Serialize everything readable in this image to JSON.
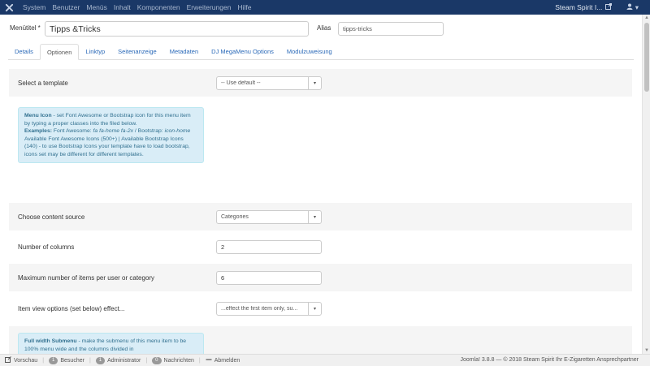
{
  "topbar": {
    "logo_icon": "joomla-icon",
    "menu": [
      "System",
      "Benutzer",
      "Menüs",
      "Inhalt",
      "Komponenten",
      "Erweiterungen",
      "Hilfe"
    ],
    "site_name": "Steam Spirit I...",
    "site_icon": "external-link-icon",
    "user_icon": "user-icon",
    "user_caret": "▾"
  },
  "form": {
    "menutitle_label": "Menütitel *",
    "menutitle_value": "Tipps &Tricks",
    "alias_label": "Alias",
    "alias_value": "tipps-tricks"
  },
  "tabs": [
    "Details",
    "Optionen",
    "Linktyp",
    "Seitenanzeige",
    "Metadaten",
    "DJ MegaMenu Options",
    "Modulzuweisung"
  ],
  "active_tab": "Optionen",
  "options": {
    "template_label": "Select a template",
    "template_value": "-- Use default --",
    "menu_icon_box": {
      "title": "Menu Icon",
      "text1": " - set Font Awesome or Bootstrap icon for this menu item by typing a proper classes into the filed below.",
      "examples_label": "Examples:",
      "examples_text": " Font Awesome: ",
      "fa_example": "fa fa-home fa-2x",
      "slash": " / Bootstrap: ",
      "bs_example": "icon-home",
      "available": "Available Font Awesome Icons (500+) | Available Bootstrap Icons (140) - to use Bootstrap Icons your template have to load bootstrap, icons set may be different for different templates."
    },
    "content_source_label": "Choose content source",
    "content_source_value": "Categories",
    "columns_label": "Number of columns",
    "columns_value": "2",
    "max_items_label": "Maximum number of items per user or category",
    "max_items_value": "6",
    "item_view_label": "Item view options (set below) effect...",
    "item_view_value": "...effect the first item only, su...",
    "full_width_box": {
      "title": "Full width Submenu",
      "text": " - make the submenu of this menu item to be 100% menu wide and the columns divided in"
    }
  },
  "statusbar": {
    "preview_icon": "eye-icon",
    "preview": "Vorschau",
    "visitors_count": "1",
    "visitors": "Besucher",
    "admin_count": "1",
    "admin": "Administrator",
    "messages_count": "0",
    "messages": "Nachrichten",
    "logout_icon": "minus-icon",
    "logout": "Abmelden",
    "footer": "Joomla! 3.8.8  —  © 2018 Steam Spirit Ihr E-Zigaretten Ansprechpartner"
  }
}
